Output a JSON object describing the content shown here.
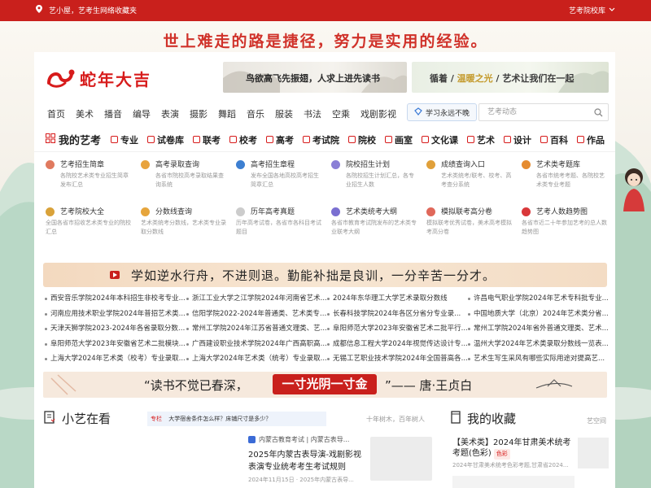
{
  "topbar": {
    "location": "艺小屋，艺考生网络收藏夹",
    "library": "艺考院校库"
  },
  "slogan": "世上难走的路是捷径，努力是实用的经验。",
  "header": {
    "logo_text": "蛇年大吉",
    "banner1": "鸟欲高飞先振翅，人求上进先读书",
    "banner2_parts": [
      "循着 / ",
      "温暖之光",
      " / 艺术让我们在一起"
    ]
  },
  "nav": {
    "items": [
      "首页",
      "美术",
      "播音",
      "编导",
      "表演",
      "摄影",
      "舞蹈",
      "音乐",
      "服装",
      "书法",
      "空乘",
      "戏剧影视",
      "···"
    ],
    "study_button": "学习永远不晚",
    "search_placeholder": "艺考动态"
  },
  "categories": {
    "mine": "我的艺考",
    "items": [
      "专业",
      "试卷库",
      "联考",
      "校考",
      "高考",
      "考试院",
      "院校",
      "画室",
      "文化课",
      "艺术",
      "设计",
      "百科",
      "作品"
    ]
  },
  "tools": [
    {
      "title": "艺考招生简章",
      "desc": "各院校艺术类专业招生简章发布汇总",
      "color": "#e07a5f"
    },
    {
      "title": "高考录取查询",
      "desc": "各省市院校高考录取结果查询系统",
      "color": "#e8a33d"
    },
    {
      "title": "高考招生章程",
      "desc": "发布全国各地高校高考招生简章汇总",
      "color": "#3d7fd1"
    },
    {
      "title": "院校招生计划",
      "desc": "各院校招生计划汇总，各专业招生人数",
      "color": "#8a7fd6"
    },
    {
      "title": "成绩查询入口",
      "desc": "艺术类统考/联考、校考、高考查分系统",
      "color": "#e0a03a"
    },
    {
      "title": "艺术类考题库",
      "desc": "各省市统考考题、各院校艺术类专业考题",
      "color": "#e58b2f"
    },
    {
      "title": "艺考院校大全",
      "desc": "全国各省市招收艺术类专业的院校汇总",
      "color": "#d9a23a"
    },
    {
      "title": "分数线查询",
      "desc": "艺术类统考分数线，艺术类专业录取分数线",
      "color": "#e6a53c"
    },
    {
      "title": "历年高考真题",
      "desc": "历年高考试卷，各省市各科目考试题目",
      "color": "#cccccc"
    },
    {
      "title": "艺术类统考大纲",
      "desc": "各省市教育考试院发布的艺术类专业联考大纲",
      "color": "#7a6fd1"
    },
    {
      "title": "模拟联考高分卷",
      "desc": "模拟联考优秀试卷，美术高考模拟考高分卷",
      "color": "#e0685a"
    },
    {
      "title": "艺考人数趋势图",
      "desc": "各省市近二十年参加艺考的总人数趋势图",
      "color": "#d9383a"
    }
  ],
  "quote": "学如逆水行舟，不进则退。勤能补拙是良训，一分辛苦一分才。",
  "news": [
    [
      "西安音乐学院2024年本科招生非校考专业...",
      "河南应用技术职业学院2024年普招艺术类...",
      "天津天狮学院2023-2024年各省录取分数线...",
      "阜阳师范大学2023年安徽省艺术二批模块...",
      "上海大学2024年艺术类（校考）专业录取..."
    ],
    [
      "浙江工业大学之江学院2024年河南省艺术...",
      "信阳学院2022-2024年普通类、艺术类专业...",
      "常州工学院2024年江苏省普通文理类、艺...",
      "广西建设职业技术学院2024年广西高职高...",
      "上海大学2024年艺术类（统考）专业录取..."
    ],
    [
      "2024年东华理工大学艺术录取分数线",
      "长春科技学院2024年各区分省分专业录...",
      "阜阳师范大学2023年安徽省艺术二批平行...",
      "成都信息工程大学2024年视觉传达设计专...",
      "无锡工艺职业技术学院2024年全国普高各..."
    ],
    [
      "许昌电气职业学院2024年艺术专科批专业...",
      "中国地质大学（北京）2024年艺术类分省...",
      "常州工学院2024年省外普通文理类、艺术...",
      "温州大学2024年艺术类录取分数线一览表...",
      "艺术生写生采风有哪些实际用途对提高艺..."
    ]
  ],
  "poem": {
    "left": "“读书不觉已春深，",
    "pill": "一寸光阴一寸金",
    "author": "”—— 唐·王贞白"
  },
  "xiaoyi": {
    "title": "小艺在看",
    "tag": "专栏",
    "tag_text": "大学宿舍条件怎么样？床铺尺寸是多少？",
    "right_note": "十年树木，百年树人",
    "article_source": "内蒙古教育考试 | 内蒙古表导...",
    "article_title": "2025年内蒙古表导演-戏剧影视表演专业统考考生考试规则",
    "article_date": "2024年11月15日 · 2025年内蒙古表导..."
  },
  "favorites": {
    "title": "我的收藏",
    "note": "艺空间",
    "item_title": "【美术类】2024年甘肃美术统考考题(色彩)",
    "item_badge": "色彩",
    "item_sub": "2024年甘肃美术统考色彩考题,甘肃省2024..."
  }
}
